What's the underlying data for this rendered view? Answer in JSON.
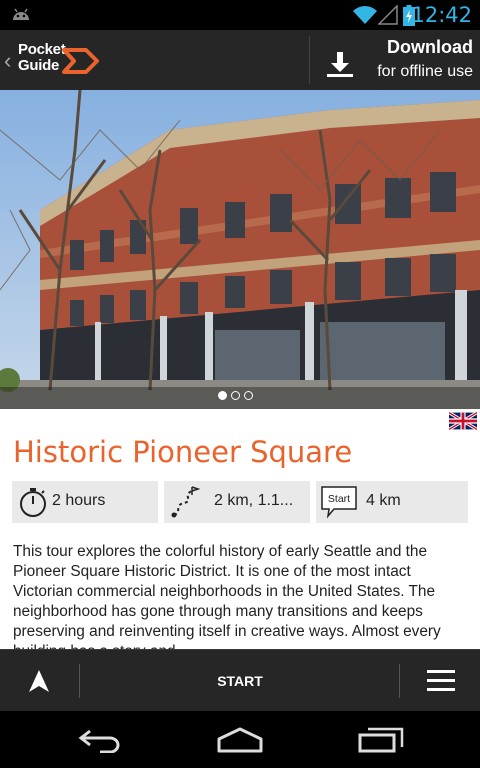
{
  "status_bar": {
    "time": "12:42",
    "icons": [
      "android-icon",
      "wifi-icon",
      "signal-icon",
      "battery-icon"
    ],
    "accent_color": "#33b5e5"
  },
  "app_bar": {
    "logo_line1": "Pocket",
    "logo_line2": "Guide",
    "download_title": "Download",
    "download_subtitle": "for offline use",
    "brand_color": "#e9642c"
  },
  "gallery": {
    "page_count": 3,
    "active_index": 0
  },
  "tour": {
    "title": "Historic Pioneer Square",
    "language_flag": "uk-flag-icon",
    "duration": "2 hours",
    "distance": "2 km, 1.1...",
    "start_distance": "4 km",
    "start_badge": "Start",
    "description": "This tour explores the colorful history of early Seattle and the Pioneer Square Historic District. It is one of the most intact Victorian commercial neighborhoods in the United States. The neighborhood has gone through many transitions and keeps preserving and reinventing itself in creative ways. Almost every building has a story and"
  },
  "toolbar": {
    "start_label": "START"
  },
  "nav_bar": {
    "buttons": [
      "back-icon",
      "home-icon",
      "recent-apps-icon"
    ]
  }
}
